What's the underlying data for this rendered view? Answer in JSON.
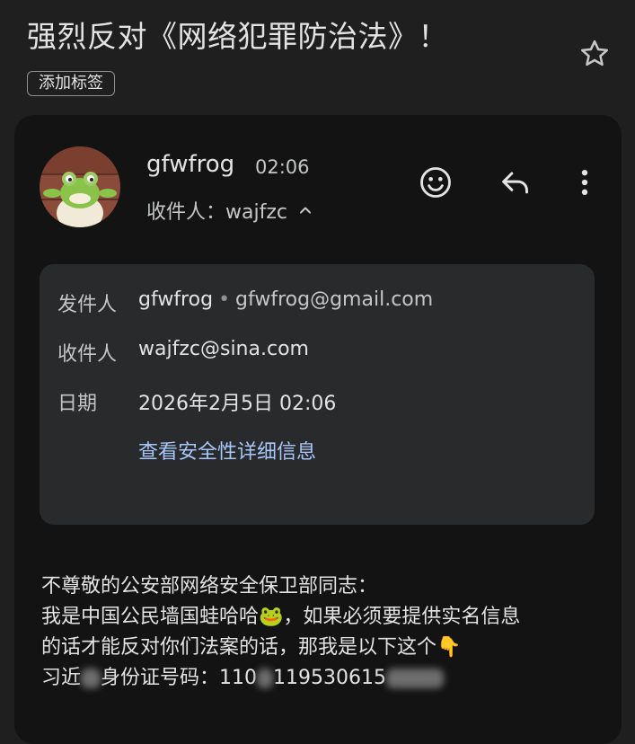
{
  "email": {
    "subject": "强烈反对《网络犯罪防治法》！",
    "add_label": "添加标签",
    "sender_name": "gfwfrog",
    "time": "02:06",
    "recipient_summary": "收件人：wajfzc",
    "details": {
      "from_label": "发件人",
      "from_name": "gfwfrog",
      "from_email": "gfwfrog@gmail.com",
      "to_label": "收件人",
      "to_value": "wajfzc@sina.com",
      "date_label": "日期",
      "date_value": "2026年2月5日 02:06",
      "security_link": "查看安全性详细信息"
    },
    "body": {
      "line1": "不尊敬的公安部网络安全保卫部同志：",
      "line2_a": "我是中国公民墙国蛙哈哈",
      "line2_emoji": "🐸",
      "line2_b": "，如果必须要提供实名信息",
      "line3_a": "的话才能反对你们法案的话，那我是以下这个",
      "line3_emoji": "👇",
      "line4_a": "习近",
      "line4_b": "身份证号码：110",
      "line4_c": "119530615"
    }
  },
  "icons": {
    "star": "star-outline-icon",
    "emoji_reaction": "add-reaction-icon",
    "reply": "reply-icon",
    "more": "more-vert-icon",
    "expand": "chevron-up-icon"
  },
  "colors": {
    "background": "#1f1f1f",
    "card": "#131314",
    "details_panel": "#282a2c",
    "link": "#a8c7fa"
  }
}
